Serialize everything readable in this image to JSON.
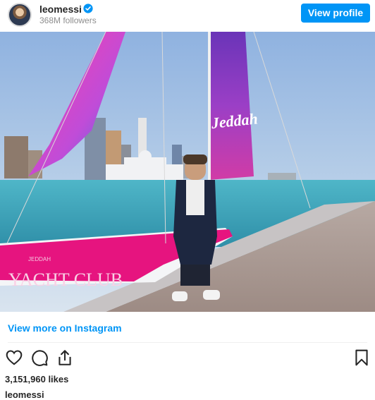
{
  "post": {
    "username": "leomessi",
    "followers": "368M followers",
    "view_profile_label": "View profile",
    "view_more_label": "View more on Instagram",
    "likes": "3,151,960 likes",
    "caption_username": "leomessi"
  },
  "image": {
    "sail_text": "Jeddah",
    "hull_text_small": "JEDDAH",
    "hull_text_large": "YACHT CLUB"
  },
  "icons": {
    "verified": "verified-badge-icon",
    "like": "heart-icon",
    "comment": "comment-bubble-icon",
    "share": "share-icon",
    "save": "bookmark-icon"
  },
  "colors": {
    "accent": "#0095f6",
    "sail_purple": "#7a3fc0",
    "hull_pink": "#e6147f"
  }
}
